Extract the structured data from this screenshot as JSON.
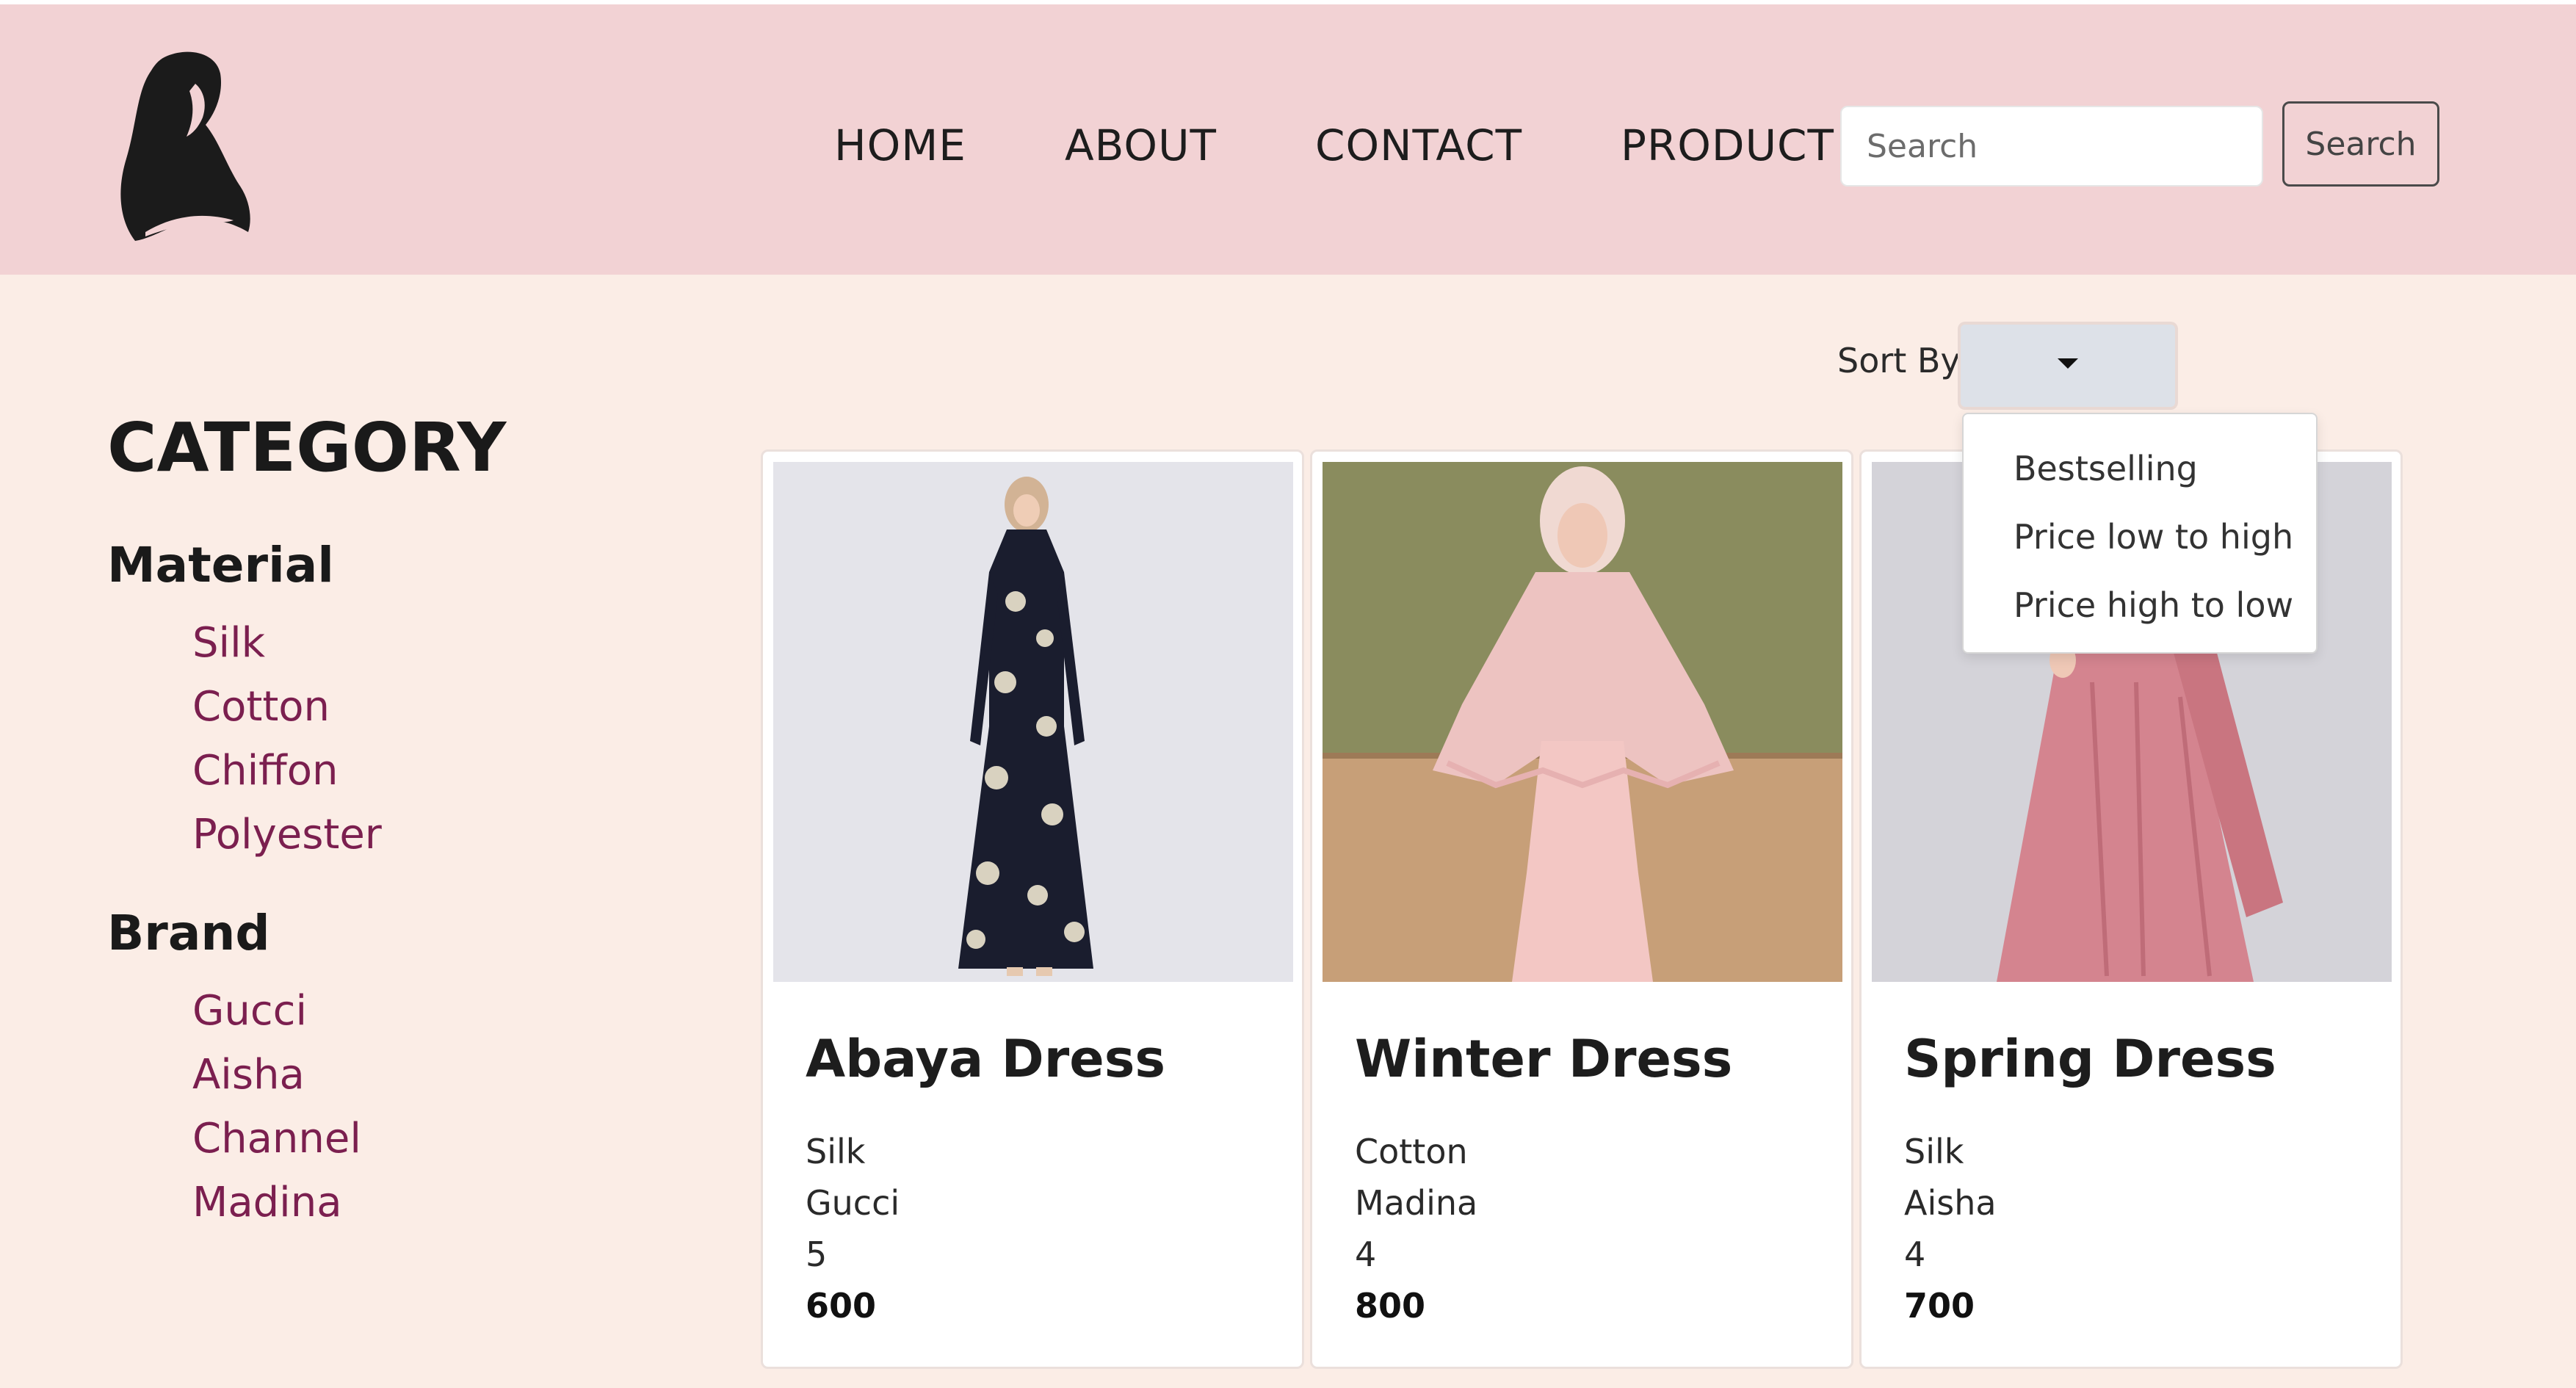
{
  "header": {
    "logo_icon": "hijab-woman-silhouette-icon",
    "nav": [
      "HOME",
      "ABOUT",
      "CONTACT",
      "PRODUCT"
    ],
    "search_placeholder": "Search",
    "search_button": "Search",
    "colors": {
      "background": "#f2d2d4"
    }
  },
  "sidebar": {
    "title": "CATEGORY",
    "groups": [
      {
        "title": "Material",
        "items": [
          "Silk",
          "Cotton",
          "Chiffon",
          "Polyester"
        ]
      },
      {
        "title": "Brand",
        "items": [
          "Gucci",
          "Aisha",
          "Channel",
          "Madina"
        ]
      }
    ],
    "colors": {
      "item": "#7b1f4f"
    }
  },
  "sort": {
    "label": "Sort By:",
    "selected": "",
    "options": [
      "Bestselling",
      "Price low to high",
      "Price high to low"
    ]
  },
  "products": [
    {
      "name": "Abaya Dress",
      "material": "Silk",
      "brand": "Gucci",
      "rating": "5",
      "price": "600"
    },
    {
      "name": "Winter Dress",
      "material": "Cotton",
      "brand": "Madina",
      "rating": "4",
      "price": "800"
    },
    {
      "name": "Spring Dress",
      "material": "Silk",
      "brand": "Aisha",
      "rating": "4",
      "price": "700"
    }
  ],
  "colors": {
    "page_background": "#fbede6"
  }
}
